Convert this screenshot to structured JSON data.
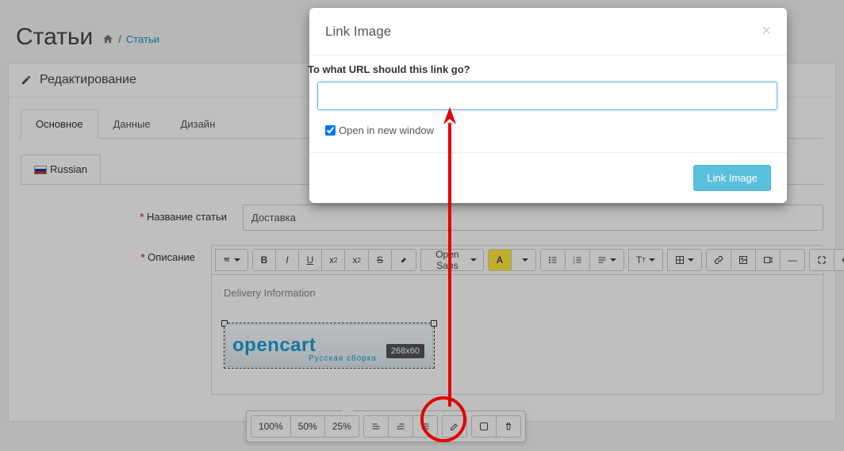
{
  "page": {
    "title": "Статьи"
  },
  "breadcrumb": {
    "sep": "/",
    "current": "Статьи"
  },
  "panel": {
    "heading": "Редактирование"
  },
  "tabs": {
    "main": "Основное",
    "data": "Данные",
    "design": "Дизайн"
  },
  "lang": {
    "russian": "Russian"
  },
  "form": {
    "title_label": "Название статьи",
    "title_value": "Доставка",
    "desc_label": "Описание"
  },
  "editor": {
    "font": "Open Sans",
    "content_text": "Delivery Information",
    "banner_text": "opencart",
    "banner_sub": "Русская сборка",
    "banner_size": "268x60"
  },
  "popover": {
    "p100": "100%",
    "p50": "50%",
    "p25": "25%"
  },
  "modal": {
    "title": "Link Image",
    "prompt": "To what URL should this link go?",
    "url_value": "",
    "checkbox_label": "Open in new window",
    "submit": "Link Image"
  }
}
